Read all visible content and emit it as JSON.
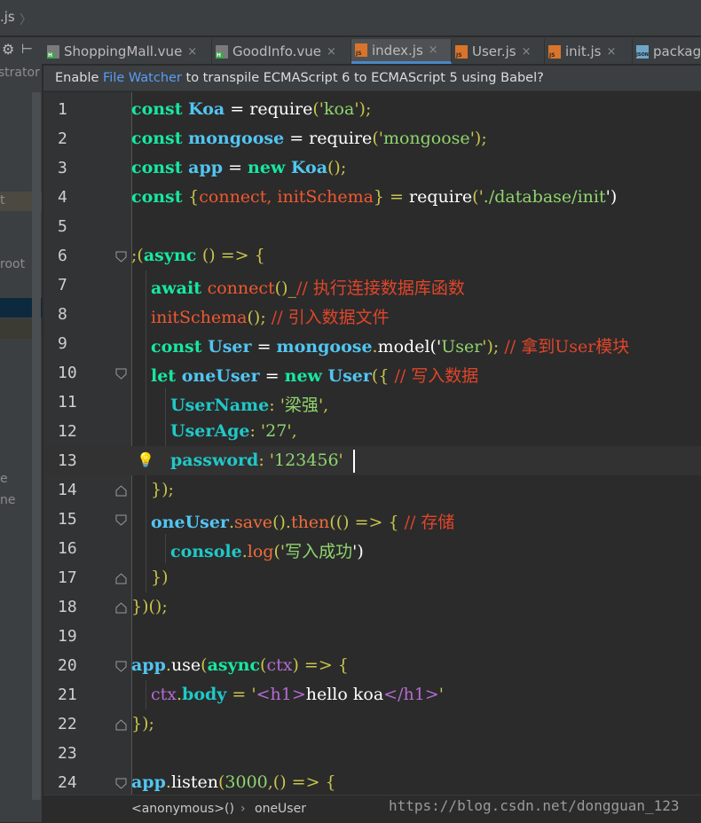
{
  "window": {
    "breadcrumb_file": ".js"
  },
  "tabs": [
    {
      "label": "ShoppingMall.vue",
      "icon": "vue-file-icon",
      "active": false
    },
    {
      "label": "GoodInfo.vue",
      "icon": "vue-file-icon",
      "active": false
    },
    {
      "label": "index.js",
      "icon": "js-file-icon",
      "active": true
    },
    {
      "label": "User.js",
      "icon": "js-file-icon",
      "active": false
    },
    {
      "label": "init.js",
      "icon": "js-file-icon",
      "active": false
    },
    {
      "label": "packag",
      "icon": "json-file-icon",
      "active": false
    }
  ],
  "icon_labels": {
    "vue": "H",
    "js": "JS",
    "json": "JSON"
  },
  "close_glyph": "×",
  "project_panel": {
    "fragments": [
      "istrator",
      "t",
      "root",
      "e",
      "ne"
    ]
  },
  "notification": {
    "prefix": "Enable ",
    "link": "File Watcher",
    "suffix": " to transpile ECMAScript 6 to ECMAScript 5 using Babel?"
  },
  "editor": {
    "current_line": 13,
    "lines": [
      {
        "n": 1,
        "text": "const Koa = require('koa');"
      },
      {
        "n": 2,
        "text": "const mongoose = require('mongoose');"
      },
      {
        "n": 3,
        "text": "const app = new Koa();"
      },
      {
        "n": 4,
        "text": "const {connect, initSchema} = require('./database/init')"
      },
      {
        "n": 5,
        "text": ""
      },
      {
        "n": 6,
        "text": ";(async () => {"
      },
      {
        "n": 7,
        "text": "await connect()_// 执行连接数据库函数"
      },
      {
        "n": 8,
        "text": "initSchema(); // 引入数据文件"
      },
      {
        "n": 9,
        "text": "const User = mongoose.model('User'); // 拿到User模块"
      },
      {
        "n": 10,
        "text": "let oneUser = new User({ // 写入数据"
      },
      {
        "n": 11,
        "text": "UserName: '梁强',"
      },
      {
        "n": 12,
        "text": "UserAge: '27',"
      },
      {
        "n": 13,
        "text": "password: '123456'"
      },
      {
        "n": 14,
        "text": "});"
      },
      {
        "n": 15,
        "text": "oneUser.save().then(() => { // 存储"
      },
      {
        "n": 16,
        "text": "console.log('写入成功')"
      },
      {
        "n": 17,
        "text": "})"
      },
      {
        "n": 18,
        "text": "})();"
      },
      {
        "n": 19,
        "text": ""
      },
      {
        "n": 20,
        "text": "app.use(async(ctx) => {"
      },
      {
        "n": 21,
        "text": "ctx.body = '<h1>hello koa</h1>'"
      },
      {
        "n": 22,
        "text": "});"
      },
      {
        "n": 23,
        "text": ""
      },
      {
        "n": 24,
        "text": "app.listen(3000,() => {"
      }
    ]
  },
  "breadcrumbs": {
    "items": [
      "<anonymous>()",
      "oneUser"
    ],
    "separator": "›"
  },
  "watermark": "https://blog.csdn.net/dongguan_123",
  "colors": {
    "keyword": "#17e8a0",
    "identifier": "#52c5f2",
    "string": "#8fd46e",
    "comment": "#e0452a",
    "function": "#f0582f",
    "punct": "#c9c44c",
    "method_call": "#f06c3a",
    "param": "#b56bd1",
    "property": "#20c8c8"
  }
}
